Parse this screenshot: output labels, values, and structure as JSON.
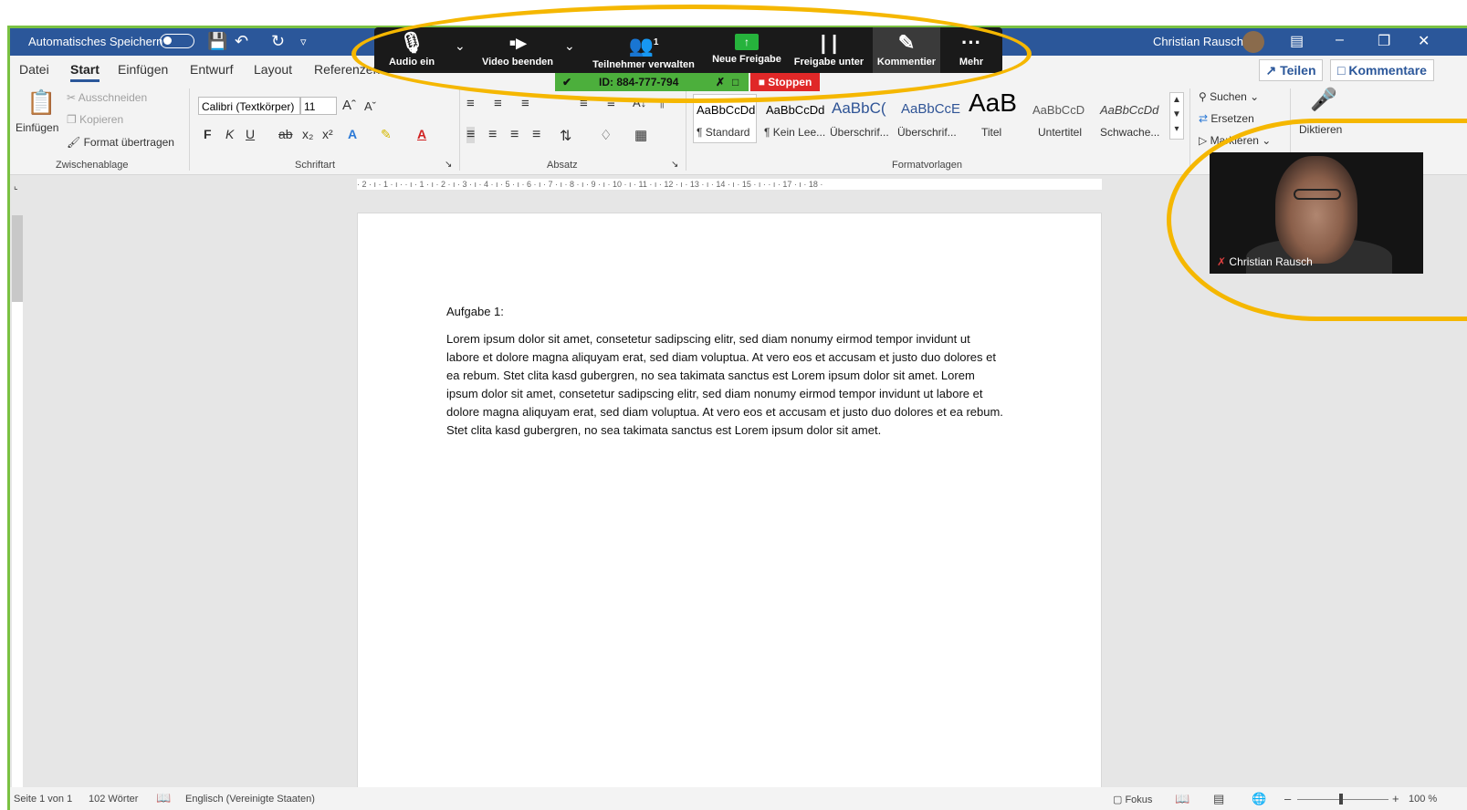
{
  "titlebar": {
    "autosave_label": "Automatisches Speichern",
    "user_name": "Christian Rausch"
  },
  "tabs": [
    "Datei",
    "Start",
    "Einfügen",
    "Entwurf",
    "Layout",
    "Referenzen"
  ],
  "share_label": "Teilen",
  "comments_label": "Kommentare",
  "ribbon": {
    "clipboard": {
      "paste": "Einfügen",
      "cut": "Ausschneiden",
      "copy": "Kopieren",
      "format_painter": "Format übertragen",
      "group": "Zwischenablage"
    },
    "font": {
      "family": "Calibri (Textkörper)",
      "size": "11",
      "group": "Schriftart",
      "bold": "F",
      "italic": "K",
      "underline": "U",
      "strike": "ab",
      "subscript": "x₂",
      "superscript": "x²"
    },
    "paragraph_group": "Absatz",
    "styles": {
      "group": "Formatvorlagen",
      "items": [
        {
          "sample": "AaBbCcDd",
          "name": "¶ Standard"
        },
        {
          "sample": "AaBbCcDd",
          "name": "¶ Kein Lee..."
        },
        {
          "sample": "AaBbC(",
          "name": "Überschrif..."
        },
        {
          "sample": "AaBbCcE",
          "name": "Überschrif..."
        },
        {
          "sample": "AaB",
          "name": "Titel"
        },
        {
          "sample": "AaBbCcD",
          "name": "Untertitel"
        },
        {
          "sample": "AaBbCcDd",
          "name": "Schwache..."
        }
      ]
    },
    "editing": {
      "search": "Suchen",
      "replace": "Ersetzen",
      "select": "Markieren"
    },
    "dictate": "Diktieren"
  },
  "ruler_text": "· 2 · ı · 1 · ı ·   · ı · 1 · ı · 2 · ı · 3 · ı · 4 · ı · 5 · ı · 6 · ı · 7 · ı · 8 · ı · 9 · ı · 10 · ı · 11 · ı · 12 · ı · 13 · ı · 14 · ı · 15 · ı ·   · ı · 17 · ı · 18 ·",
  "document": {
    "heading": "Aufgabe 1:",
    "body": "Lorem ipsum dolor sit amet, consetetur sadipscing elitr, sed diam nonumy eirmod tempor invidunt ut labore et dolore magna aliquyam erat, sed diam voluptua. At vero eos et accusam et justo duo dolores et ea rebum. Stet clita kasd gubergren, no sea takimata sanctus est Lorem ipsum dolor sit amet. Lorem ipsum dolor sit amet, consetetur sadipscing elitr, sed diam nonumy eirmod tempor invidunt ut labore et dolore magna aliquyam erat, sed diam voluptua. At vero eos et accusam et justo duo dolores et ea rebum. Stet clita kasd gubergren, no sea takimata sanctus est Lorem ipsum dolor sit amet."
  },
  "statusbar": {
    "page": "Seite 1 von 1",
    "words": "102 Wörter",
    "language": "Englisch (Vereinigte Staaten)",
    "focus": "Fokus",
    "zoom": "100 %"
  },
  "zoom_toolbar": {
    "audio": "Audio ein",
    "video": "Video beenden",
    "participants": "Teilnehmer verwalten",
    "participant_count": "1",
    "new_share": "Neue Freigabe",
    "pause_share": "Freigabe unter",
    "annotate": "Kommentier",
    "more": "Mehr",
    "meeting_id": "ID: 884-777-794",
    "stop": "Stoppen"
  },
  "video_tile": {
    "name": "Christian Rausch"
  },
  "colors": {
    "word_blue": "#2b579a",
    "highlight_yellow": "#f5b700",
    "zoom_green": "#4caf3c",
    "zoom_red": "#e02828",
    "border_green": "#7ac142"
  }
}
